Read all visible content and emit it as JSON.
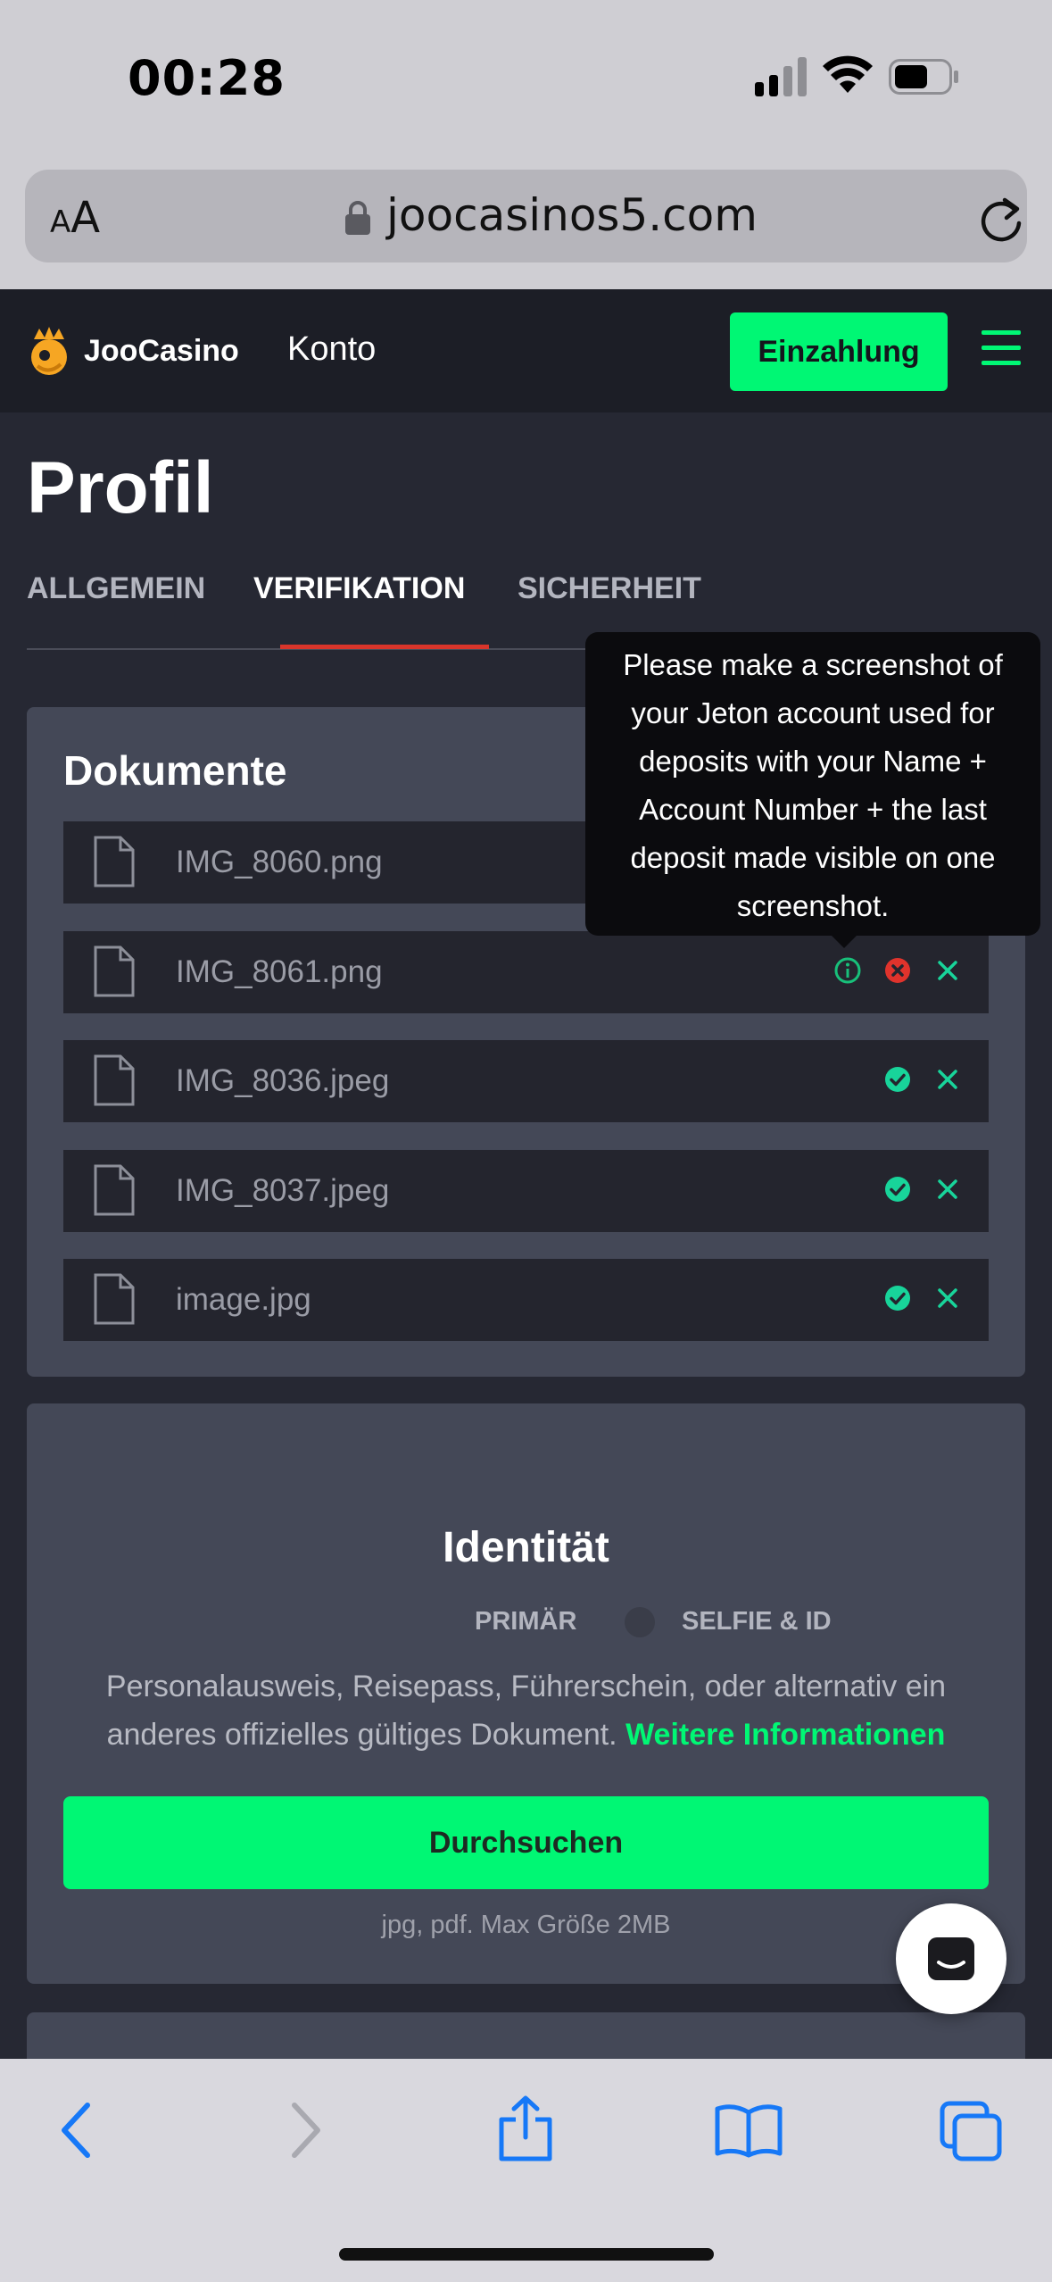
{
  "status_bar": {
    "time": "00:28"
  },
  "browser": {
    "text_size_small": "A",
    "text_size_large": "A",
    "url": "joocasinos5.com"
  },
  "header": {
    "logo": "JooCasino",
    "section": "Konto",
    "deposit_label": "Einzahlung"
  },
  "profile": {
    "title": "Profil",
    "tabs": [
      {
        "label": "ALLGEMEIN",
        "active": false
      },
      {
        "label": "VERIFIKATION",
        "active": true
      },
      {
        "label": "SICHERHEIT",
        "active": false
      }
    ]
  },
  "documents": {
    "title": "Dokumente",
    "files": [
      {
        "name": "IMG_8060.png",
        "status": "hidden"
      },
      {
        "name": "IMG_8061.png",
        "status": "rejected"
      },
      {
        "name": "IMG_8036.jpeg",
        "status": "approved"
      },
      {
        "name": "IMG_8037.jpeg",
        "status": "approved"
      },
      {
        "name": "image.jpg",
        "status": "approved"
      }
    ],
    "tooltip_lines": [
      "Please make a screenshot of",
      "your Jeton account used for",
      "deposits with your Name +",
      "Account Number + the last",
      "deposit made visible on one",
      "screenshot."
    ]
  },
  "identity": {
    "title": "Identität",
    "tab_primary": "PRIMÄR",
    "tab_selfie": "SELFIE & ID",
    "description": "Personalausweis, Reisepass, Führerschein, oder alternativ ein anderes offizielles gültiges Dokument.",
    "more_info": "Weitere Informationen",
    "browse_label": "Durchsuchen",
    "hint": "jpg, pdf. Max Größe 2MB"
  },
  "colors": {
    "accent_green": "#00f774",
    "reject_red": "#e0332c",
    "approve_teal": "#18d49a",
    "tab_underline": "#d8352b"
  },
  "icons": {
    "file": "file-icon",
    "info": "info-icon",
    "rejected": "x-circle-icon",
    "approved": "check-circle-icon",
    "remove": "close-icon",
    "chat": "chat-icon"
  }
}
